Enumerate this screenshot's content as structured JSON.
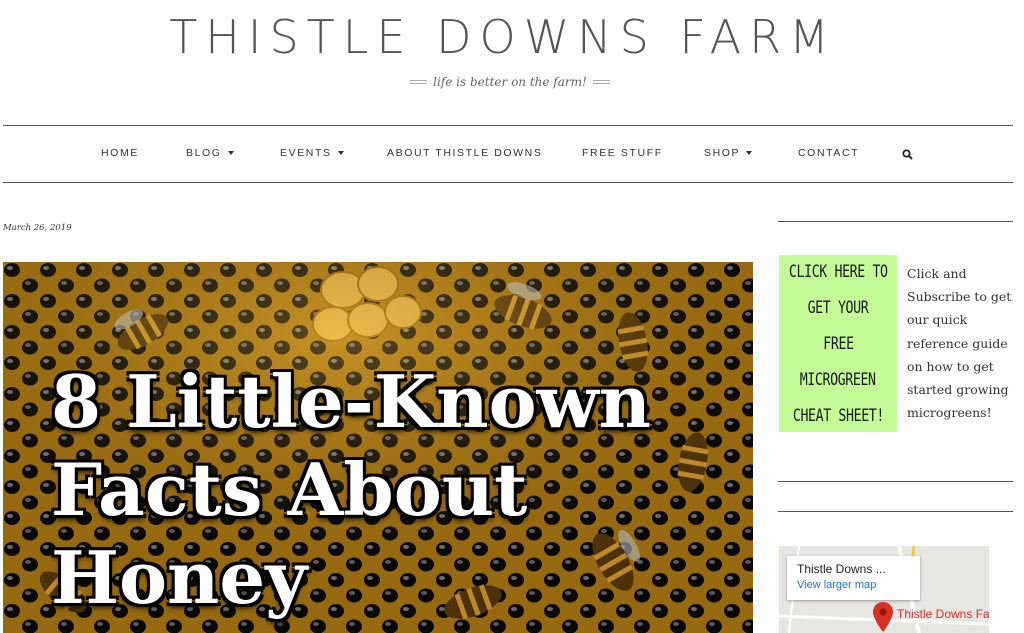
{
  "header": {
    "site_title": "THISTLE DOWNS FARM",
    "tagline": "life is better on the farm!"
  },
  "nav": {
    "items": [
      {
        "label": "HOME",
        "dropdown": false
      },
      {
        "label": "BLOG",
        "dropdown": true
      },
      {
        "label": "EVENTS",
        "dropdown": true
      },
      {
        "label": "ABOUT THISTLE DOWNS",
        "dropdown": false
      },
      {
        "label": "FREE STUFF",
        "dropdown": false
      },
      {
        "label": "SHOP",
        "dropdown": true
      },
      {
        "label": "CONTACT",
        "dropdown": false
      }
    ],
    "search_icon": "search-icon"
  },
  "post": {
    "date": "March 26, 2019",
    "hero_lines": [
      "8 Little-Known",
      "Facts About",
      "Honey"
    ]
  },
  "sidebar": {
    "promo_lines": [
      "CLICK HERE TO",
      "GET YOUR",
      "FREE",
      "MICROGREEN",
      "CHEAT SHEET!"
    ],
    "promo_text": "Click and Subscribe to get our quick reference guide on how to get started growing microgreens!",
    "map": {
      "place_name": "Thistle Downs ...",
      "link": "View larger map",
      "pin_label": "Thistle Downs Far"
    }
  },
  "colors": {
    "promo_bg": "#c3fb97",
    "map_link": "#1a73e8",
    "map_pin": "#d93025"
  }
}
